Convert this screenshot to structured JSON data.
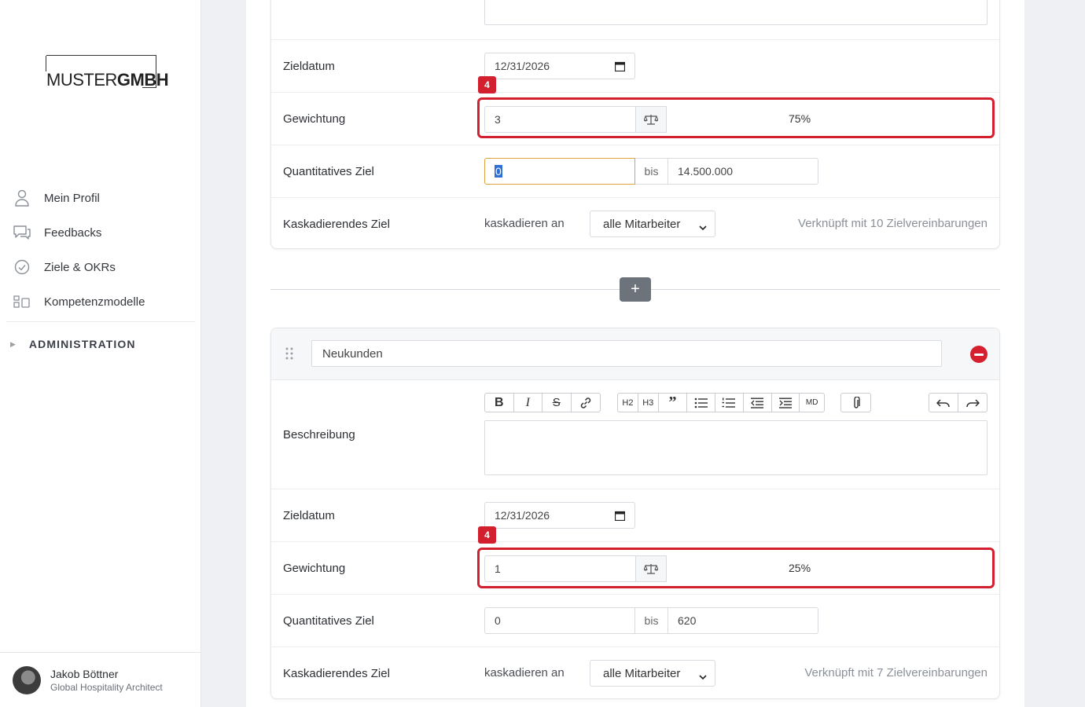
{
  "logo": {
    "light": "MUSTER",
    "bold": "GMBH"
  },
  "nav": [
    {
      "label": "Mein Profil",
      "icon": "user-icon"
    },
    {
      "label": "Feedbacks",
      "icon": "chat-icon"
    },
    {
      "label": "Ziele & OKRs",
      "icon": "check-circle-icon"
    },
    {
      "label": "Kompetenzmodelle",
      "icon": "blocks-icon"
    }
  ],
  "admin_label": "ADMINISTRATION",
  "user": {
    "name": "Jakob Böttner",
    "role": "Global Hospitality Architect"
  },
  "goal1": {
    "zieldatum_label": "Zieldatum",
    "zieldatum_value": "12/31/2026",
    "gewichtung_label": "Gewichtung",
    "gewichtung_value": "3",
    "gewichtung_pct": "75%",
    "badge": "4",
    "quant_label": "Quantitatives Ziel",
    "quant_from": "0",
    "quant_bis": "bis",
    "quant_to": "14.500.000",
    "kask_label": "Kaskadierendes Ziel",
    "kask_an": "kaskadieren an",
    "kask_select": "alle Mitarbeiter",
    "kask_link": "Verknüpft mit 10 Zielvereinbarungen"
  },
  "add_button": "+",
  "goal2": {
    "title": "Neukunden",
    "beschreibung_label": "Beschreibung",
    "toolbar": {
      "h2": "H2",
      "h3": "H3",
      "md": "MD"
    },
    "zieldatum_label": "Zieldatum",
    "zieldatum_value": "12/31/2026",
    "gewichtung_label": "Gewichtung",
    "gewichtung_value": "1",
    "gewichtung_pct": "25%",
    "badge": "4",
    "quant_label": "Quantitatives Ziel",
    "quant_from": "0",
    "quant_bis": "bis",
    "quant_to": "620",
    "kask_label": "Kaskadierendes Ziel",
    "kask_an": "kaskadieren an",
    "kask_select": "alle Mitarbeiter",
    "kask_link": "Verknüpft mit 7 Zielvereinbarungen"
  },
  "colors": {
    "highlight": "#d2202f",
    "accent_focus": "#e0a23a",
    "remove": "#d6202f"
  }
}
